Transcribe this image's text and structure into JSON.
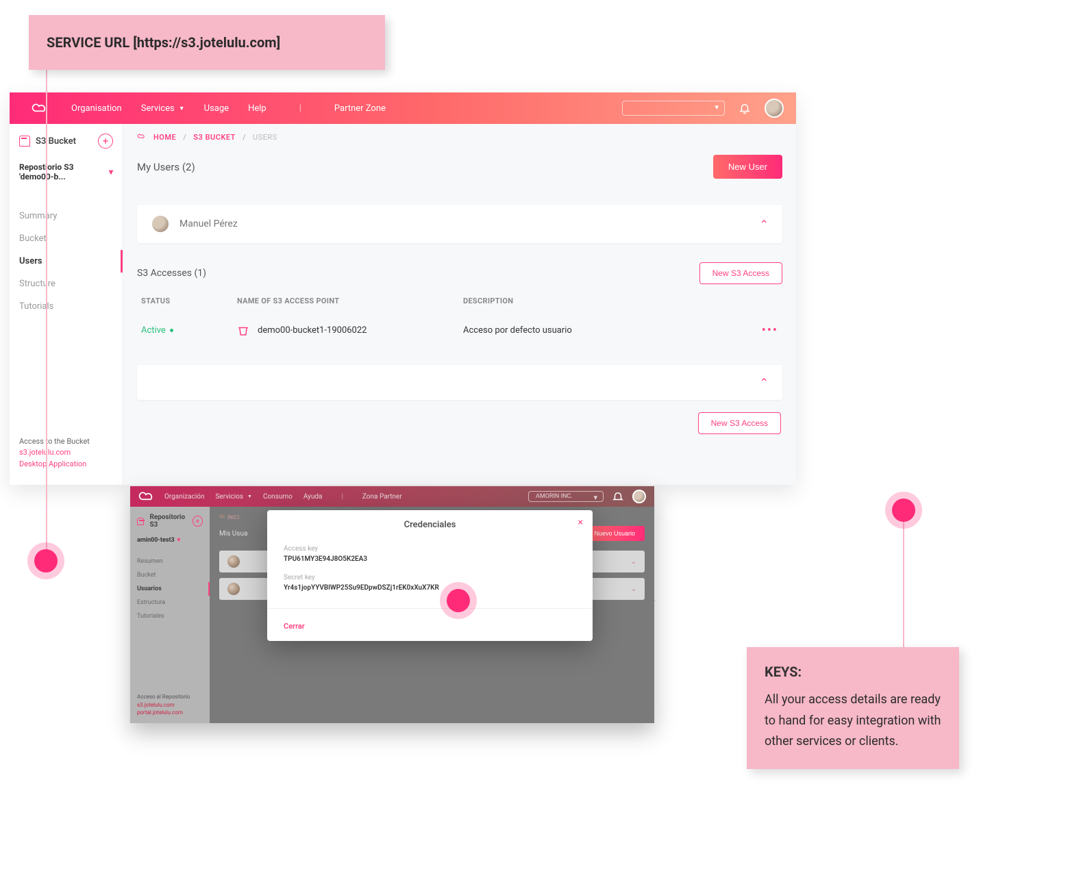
{
  "callout_url": "SERVICE URL [https://s3.jotelulu.com]",
  "topnav": {
    "items": [
      "Organisation",
      "Services",
      "Usage",
      "Help"
    ],
    "partner": "Partner Zone",
    "org": ""
  },
  "sidebar": {
    "title": "S3 Bucket",
    "repo": "Repostiorio S3 'demo00-b...",
    "links": [
      "Summary",
      "Bucket",
      "Users",
      "Structure",
      "Tutorials"
    ],
    "footer": {
      "heading": "Access to the Bucket",
      "link1": "s3.jotelulu.com",
      "link2": "Desktop Application"
    }
  },
  "breadcrumb": {
    "home": "HOME",
    "mid": "S3 BUCKET",
    "leaf": "USERS"
  },
  "heading": "My Users (2)",
  "new_user_btn": "New User",
  "user_card": {
    "name": "Manuel Pérez"
  },
  "access": {
    "heading": "S3 Accesses (1)",
    "new_btn": "New S3 Access",
    "cols": {
      "status": "STATUS",
      "name": "NAME OF S3 ACCESS POINT",
      "desc": "DESCRIPTION"
    },
    "row": {
      "status": "Active",
      "name": "demo00-bucket1-19006022",
      "desc": "Acceso por defecto usuario"
    }
  },
  "mini": {
    "nav": [
      "Organización",
      "Servicios",
      "Consumo",
      "Ayuda"
    ],
    "partner": "Zona Partner",
    "org": "AMORIN INC.",
    "sb_title": "Repositorio S3",
    "repo": "amin00-test3",
    "links": [
      "Resumen",
      "Bucket",
      "Usuarios",
      "Estructura",
      "Tutoriales"
    ],
    "bc": "INICI",
    "heading": "Mis Usua",
    "btn": "Nuevo Usuario",
    "footer": {
      "heading": "Acceso al Repositorio",
      "l1": "s3.jotelulu.com",
      "l2": "portal.jotelulu.com"
    }
  },
  "modal": {
    "title": "Credenciales",
    "access_label": "Access key",
    "access_val": "TPU61MY3E94J8O5K2EA3",
    "secret_label": "Secret key",
    "secret_val": "Yr4s1jopYYVBlWP25Su9EDpwDSZj1rEK0xXuX7KR",
    "close": "Cerrar"
  },
  "keys_callout": {
    "title": "KEYS:",
    "body": "All your access details are ready to hand for easy integration with other services or clients."
  }
}
